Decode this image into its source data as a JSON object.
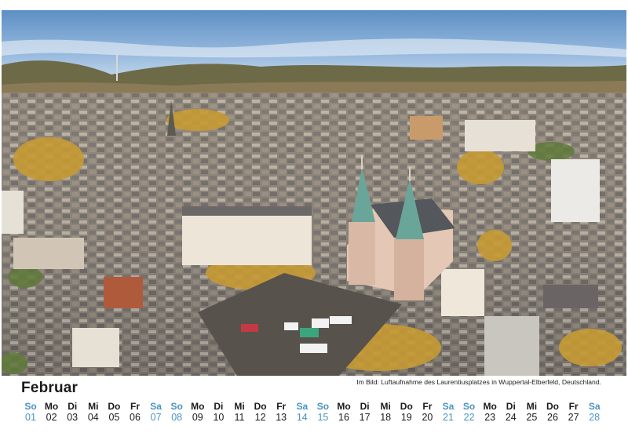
{
  "month": "Februar",
  "caption": "Im Bild: Luftaufnahme des Laurentiusplatzes in Wuppertal-Elberfeld, Deutschland.",
  "colors": {
    "weekend": "#4a93c0",
    "weekday": "#1a1a1a"
  },
  "days": [
    {
      "wd": "So",
      "dn": "01",
      "weekend": true
    },
    {
      "wd": "Mo",
      "dn": "02",
      "weekend": false
    },
    {
      "wd": "Di",
      "dn": "03",
      "weekend": false
    },
    {
      "wd": "Mi",
      "dn": "04",
      "weekend": false
    },
    {
      "wd": "Do",
      "dn": "05",
      "weekend": false
    },
    {
      "wd": "Fr",
      "dn": "06",
      "weekend": false
    },
    {
      "wd": "Sa",
      "dn": "07",
      "weekend": true
    },
    {
      "wd": "So",
      "dn": "08",
      "weekend": true
    },
    {
      "wd": "Mo",
      "dn": "09",
      "weekend": false
    },
    {
      "wd": "Di",
      "dn": "10",
      "weekend": false
    },
    {
      "wd": "Mi",
      "dn": "11",
      "weekend": false
    },
    {
      "wd": "Do",
      "dn": "12",
      "weekend": false
    },
    {
      "wd": "Fr",
      "dn": "13",
      "weekend": false
    },
    {
      "wd": "Sa",
      "dn": "14",
      "weekend": true
    },
    {
      "wd": "So",
      "dn": "15",
      "weekend": true
    },
    {
      "wd": "Mo",
      "dn": "16",
      "weekend": false
    },
    {
      "wd": "Di",
      "dn": "17",
      "weekend": false
    },
    {
      "wd": "Mi",
      "dn": "18",
      "weekend": false
    },
    {
      "wd": "Do",
      "dn": "19",
      "weekend": false
    },
    {
      "wd": "Fr",
      "dn": "20",
      "weekend": false
    },
    {
      "wd": "Sa",
      "dn": "21",
      "weekend": true
    },
    {
      "wd": "So",
      "dn": "22",
      "weekend": true
    },
    {
      "wd": "Mo",
      "dn": "23",
      "weekend": false
    },
    {
      "wd": "Di",
      "dn": "24",
      "weekend": false
    },
    {
      "wd": "Mi",
      "dn": "25",
      "weekend": false
    },
    {
      "wd": "Do",
      "dn": "26",
      "weekend": false
    },
    {
      "wd": "Fr",
      "dn": "27",
      "weekend": false
    },
    {
      "wd": "Sa",
      "dn": "28",
      "weekend": true
    }
  ]
}
